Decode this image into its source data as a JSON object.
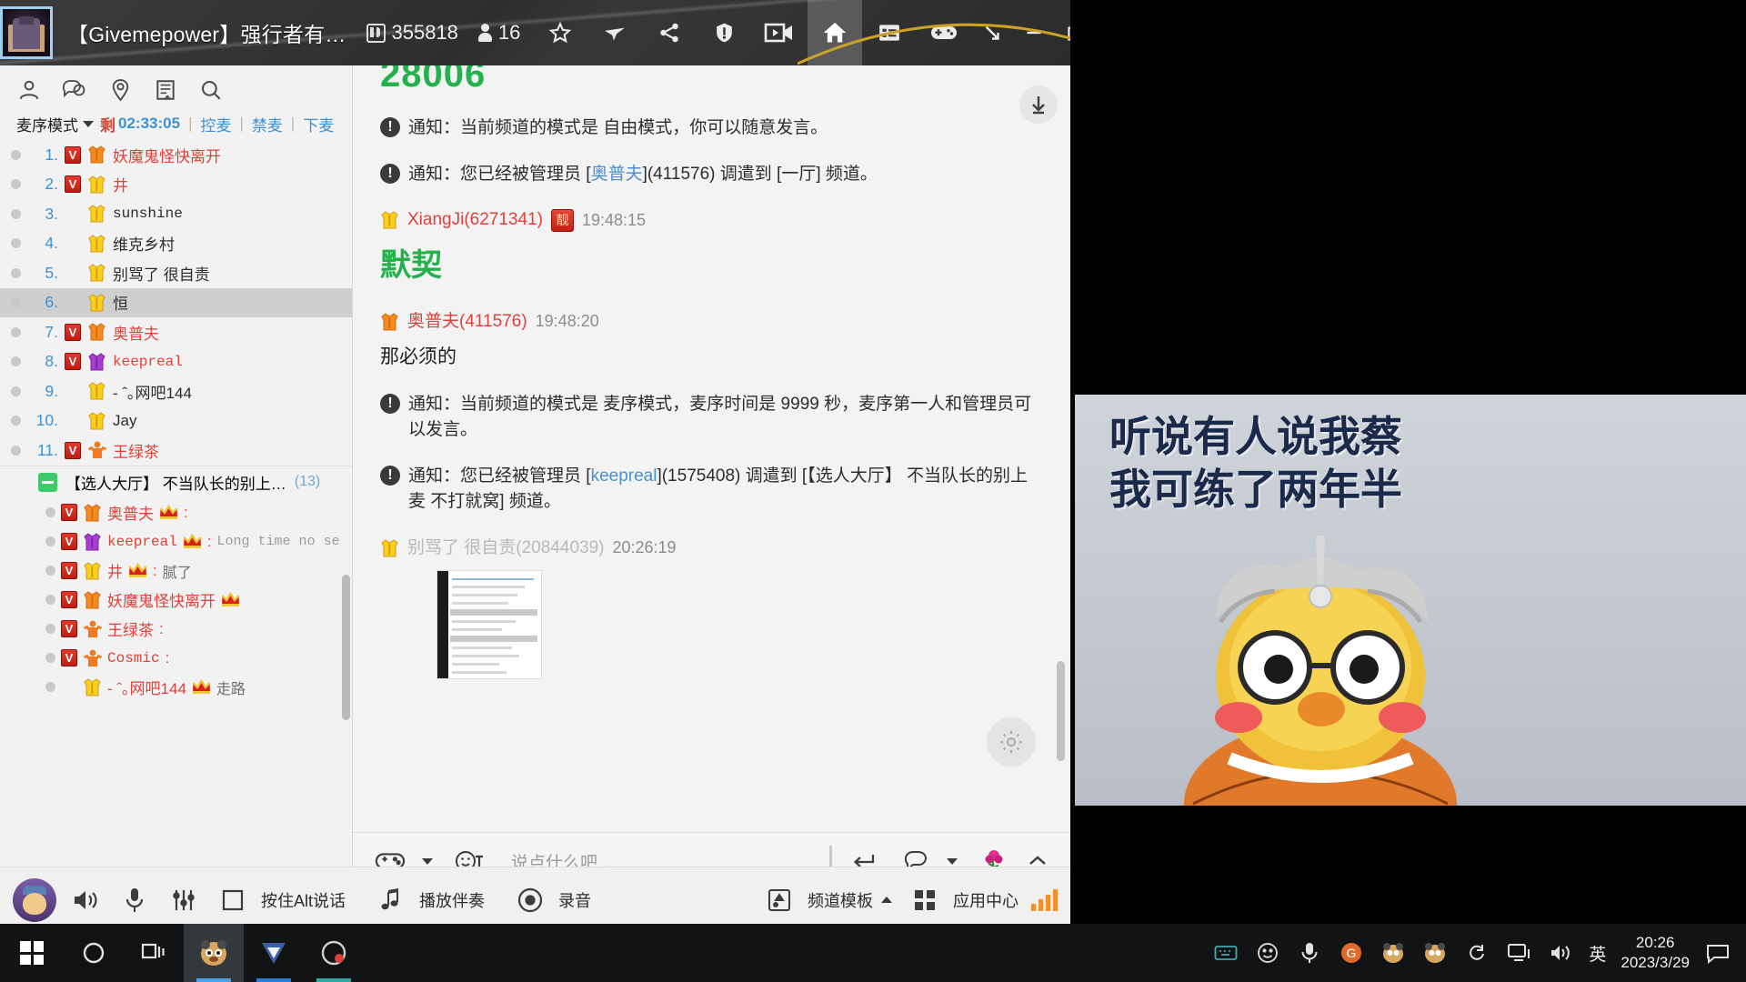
{
  "titlebar": {
    "window_title": "【Givemepower】强行者有…",
    "channel_id_label": "355818",
    "member_count": "16",
    "icons": [
      {
        "name": "id-badge-icon"
      },
      {
        "name": "people-count-icon"
      },
      {
        "name": "star-icon"
      },
      {
        "name": "airplane-icon"
      },
      {
        "name": "share-icon"
      },
      {
        "name": "alert-shield-icon"
      },
      {
        "name": "video-camera-icon"
      },
      {
        "name": "home-icon"
      },
      {
        "name": "list-panel-icon"
      },
      {
        "name": "gamepad-icon"
      }
    ],
    "window_controls": [
      "minimize-to-tray",
      "minimize",
      "restore",
      "power"
    ]
  },
  "sidebar": {
    "tools": [
      "contacts-icon",
      "chat-bubble-icon",
      "location-pin-icon",
      "notes-icon",
      "search-icon"
    ],
    "mic_bar": {
      "mode_label": "麦序模式",
      "remaining_label": "剩",
      "remaining_time": "02:33:05",
      "links": [
        "控麦",
        "禁麦",
        "下麦"
      ]
    },
    "mic_list": [
      {
        "index": "1.",
        "vip": true,
        "shirt": "orange",
        "name": "妖魔鬼怪快离开",
        "style": "red",
        "selected": false
      },
      {
        "index": "2.",
        "vip": true,
        "shirt": "yellow",
        "name": "井",
        "style": "red",
        "selected": false
      },
      {
        "index": "3.",
        "vip": false,
        "shirt": "yellow",
        "name": "sunshine",
        "style": "mono",
        "selected": false
      },
      {
        "index": "4.",
        "vip": false,
        "shirt": "yellow",
        "name": "维克乡村",
        "style": "dark",
        "selected": false
      },
      {
        "index": "5.",
        "vip": false,
        "shirt": "yellow",
        "name": "别骂了 很自责",
        "style": "dark",
        "selected": false
      },
      {
        "index": "6.",
        "vip": false,
        "shirt": "yellow",
        "name": "恒",
        "style": "dark",
        "selected": true
      },
      {
        "index": "7.",
        "vip": true,
        "shirt": "orange",
        "name": "奥普夫",
        "style": "red",
        "selected": false
      },
      {
        "index": "8.",
        "vip": true,
        "shirt": "purple",
        "name": "keepreal",
        "style": "mono-red",
        "selected": false
      },
      {
        "index": "9.",
        "vip": false,
        "shirt": "yellow",
        "name": "- ˆ｡网吧144",
        "style": "dark",
        "selected": false
      },
      {
        "index": "10.",
        "vip": false,
        "shirt": "yellow",
        "name": "Jay",
        "style": "dark",
        "selected": false
      },
      {
        "index": "11.",
        "vip": true,
        "shirt": "orange-person",
        "name": "王绿茶",
        "style": "red",
        "selected": false
      }
    ],
    "channel": {
      "title": "【选人大厅】 不当队长的别上…",
      "count": "(13)"
    },
    "channel_members": [
      {
        "vip": true,
        "shirt": "orange",
        "name": "奥普夫",
        "crown": true,
        "colon": ":",
        "msg": ""
      },
      {
        "vip": true,
        "shirt": "purple",
        "name": "keepreal",
        "crown": true,
        "colon": ":",
        "msg": "Long time no se"
      },
      {
        "vip": true,
        "shirt": "yellow",
        "name": "井",
        "crown": true,
        "colon": ":",
        "msg": "腻了"
      },
      {
        "vip": true,
        "shirt": "orange",
        "name": "妖魔鬼怪快离开",
        "crown": true,
        "colon": "",
        "msg": ""
      },
      {
        "vip": true,
        "shirt": "orange-person",
        "name": "王绿茶",
        "crown": false,
        "colon": ":",
        "msg": ""
      },
      {
        "vip": true,
        "shirt": "orange-person",
        "name": "Cosmic",
        "crown": false,
        "colon": ":",
        "msg": ""
      },
      {
        "vip": false,
        "shirt": "yellow",
        "name": "- ˆ｡网吧144",
        "crown": true,
        "colon": "",
        "msg": "走路"
      }
    ]
  },
  "chat": {
    "top_fragment": "28006",
    "messages": [
      {
        "type": "notice",
        "text": "通知：当前频道的模式是 自由模式，你可以随意发言。"
      },
      {
        "type": "notice",
        "text_parts": [
          "通知：您已经被管理员 [",
          "奥普夫",
          "](411576) 调遣到 [一厅] 频道。"
        ],
        "link": "奥普夫"
      },
      {
        "type": "user",
        "name": "XiangJi(6271341)",
        "liang_badge": "靓",
        "time": "19:48:15",
        "body": "默契",
        "body_style": "green-large"
      },
      {
        "type": "user",
        "name": "奥普夫(411576)",
        "time": "19:48:20",
        "body": "那必须的",
        "body_style": "normal"
      },
      {
        "type": "notice",
        "text": "通知：当前频道的模式是 麦序模式，麦序时间是 9999 秒，麦序第一人和管理员可以发言。"
      },
      {
        "type": "notice",
        "text_parts": [
          "通知：您已经被管理员 [",
          "keepreal",
          "](1575408) 调遣到 [【选人大厅】 不当队长的别上麦 不打就窝] 频道。"
        ],
        "link": "keepreal"
      },
      {
        "type": "user",
        "name": "别骂了 很自责(20844039)",
        "time": "20:26:19",
        "body": "",
        "attachment": "screenshot-thumbnail"
      }
    ],
    "input_placeholder": "说点什么吧...",
    "input_value": "",
    "input_icons": [
      "gamepad-emoji-icon",
      "chevron-down-icon",
      "face-text-icon",
      "enter-icon",
      "chat-bubble-icon",
      "chevron-down-icon",
      "flower-icon",
      "chevron-up-icon"
    ],
    "scroll_down_icon": "arrow-down-icon",
    "gear_icon": "gear-icon"
  },
  "bottombar": {
    "avatar_icon": "avatar-icon",
    "speaker_icon": "speaker-icon",
    "mic_icon": "microphone-icon",
    "equalizer_icon": "equalizer-icon",
    "ptt_label": "按住Alt说话",
    "ptt_icon": "square-icon",
    "accompany_label": "播放伴奏",
    "accompany_icon": "music-note-icon",
    "record_label": "录音",
    "record_icon": "record-circle-icon",
    "template_label": "频道模板",
    "template_icon": "template-icon",
    "appcenter_label": "应用中心",
    "appcenter_icon": "grid-icon",
    "signal_icon": "signal-bars-icon"
  },
  "video_overlay": {
    "caption": "听说有人说我蔡\n我可练了两年半"
  },
  "taskbar": {
    "start_icon": "windows-start-icon",
    "search_icon": "cortana-circle-icon",
    "taskview_icon": "task-view-icon",
    "apps": [
      {
        "name": "yy-app",
        "active": true
      },
      {
        "name": "yf-app",
        "active": false
      },
      {
        "name": "browser-app",
        "active": false
      }
    ],
    "tray_icons": [
      "keyboard-icon",
      "smiley-icon",
      "microphone-icon",
      "g-icon",
      "panda-icon-1",
      "panda-icon-2",
      "refresh-icon",
      "monitor-icon",
      "volume-icon"
    ],
    "ime_label": "英",
    "clock_time": "20:26",
    "clock_date": "2023/3/29",
    "notification_icon": "notification-icon"
  },
  "colors": {
    "accent_blue": "#3a92d8",
    "red_name": "#e2403a",
    "green_text": "#23b14c",
    "titlebar_bg": "#2e2e2e",
    "sidebar_bg": "#f2f2f2",
    "selected_row": "#cfcfcf"
  }
}
